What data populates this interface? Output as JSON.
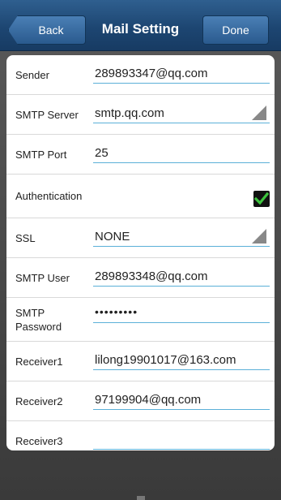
{
  "header": {
    "back_label": "Back",
    "title": "Mail Setting",
    "done_label": "Done"
  },
  "form": {
    "sender": {
      "label": "Sender",
      "value": "289893347@qq.com"
    },
    "smtp_server": {
      "label": "SMTP Server",
      "value": "smtp.qq.com"
    },
    "smtp_port": {
      "label": "SMTP Port",
      "value": "25"
    },
    "authentication": {
      "label": "Authentication",
      "checked": true
    },
    "ssl": {
      "label": "SSL",
      "value": "NONE"
    },
    "smtp_user": {
      "label": "SMTP User",
      "value": "289893348@qq.com"
    },
    "smtp_password": {
      "label": "SMTP Password",
      "value": "•••••••••"
    },
    "receiver1": {
      "label": "Receiver1",
      "value": "lilong19901017@163.com"
    },
    "receiver2": {
      "label": "Receiver2",
      "value": "97199904@qq.com"
    },
    "receiver3": {
      "label": "Receiver3",
      "value": ""
    }
  },
  "colors": {
    "header_bg": "#1d4672",
    "underline": "#5bb0d8",
    "checkmark": "#3ec43e"
  }
}
